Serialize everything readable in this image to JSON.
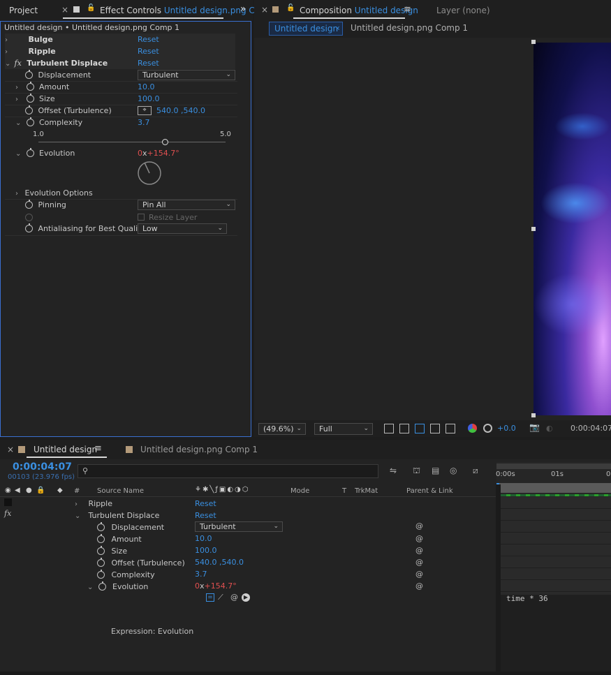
{
  "project_tab": "Project",
  "effect_tab": {
    "label": "Effect Controls",
    "file": "Untitled design.png C"
  },
  "ec_header": "Untitled design • Untitled design.png Comp 1",
  "effects": [
    {
      "name": "Bulge",
      "reset": "Reset"
    },
    {
      "name": "Ripple",
      "reset": "Reset"
    },
    {
      "name": "Turbulent Displace",
      "reset": "Reset"
    }
  ],
  "fx_label": "fx",
  "props": {
    "displacement": {
      "label": "Displacement",
      "value": "Turbulent"
    },
    "amount": {
      "label": "Amount",
      "value": "10.0"
    },
    "size": {
      "label": "Size",
      "value": "100.0"
    },
    "offset": {
      "label": "Offset (Turbulence)",
      "value": "540.0 ,540.0"
    },
    "complexity": {
      "label": "Complexity",
      "value": "3.7",
      "slider_min": "1.0",
      "slider_max": "5.0",
      "slider_fraction": 0.675
    },
    "evolution": {
      "label": "Evolution",
      "rev": "0",
      "x": "x",
      "deg": "+154.7",
      "deg_unit": "°"
    },
    "evolution_options": "Evolution Options",
    "pinning": {
      "label": "Pinning",
      "value": "Pin All"
    },
    "resize_layer": "Resize Layer",
    "antialias": {
      "label": "Antialiasing for Best Quality",
      "value": "Low"
    }
  },
  "comp_tab": {
    "label": "Composition",
    "name": "Untitled design"
  },
  "layer_tab": "Layer (none)",
  "breadcrumbs": [
    "Untitled design",
    "Untitled design.png Comp 1"
  ],
  "viewer_bar": {
    "zoom": "(49.6%)",
    "resolution": "Full",
    "exposure": "+0.0",
    "timecode": "0:00:04:07"
  },
  "timeline": {
    "tab1": "Untitled design",
    "tab2": "Untitled design.png Comp 1",
    "timecode": "0:00:04:07",
    "frames": "00103 (23.976 fps)",
    "search_placeholder": "",
    "columns": {
      "hash": "#",
      "source": "Source Name",
      "mode": "Mode",
      "t": "T",
      "trkmat": "TrkMat",
      "parent": "Parent & Link"
    },
    "ruler": [
      "0:00s",
      "01s",
      "0"
    ],
    "rows": [
      {
        "label": "Ripple",
        "value": "Reset"
      },
      {
        "label": "Turbulent Displace",
        "value": "Reset"
      },
      {
        "label": "Displacement",
        "value": "Turbulent"
      },
      {
        "label": "Amount",
        "value": "10.0"
      },
      {
        "label": "Size",
        "value": "100.0"
      },
      {
        "label": "Offset (Turbulence)",
        "value": "540.0 ,540.0"
      },
      {
        "label": "Complexity",
        "value": "3.7"
      },
      {
        "label": "Evolution",
        "rev": "0",
        "x": "x",
        "deg": "+154.7",
        "deg_unit": "°"
      }
    ],
    "expression_label": "Expression: Evolution",
    "expression_code": "time * 36"
  },
  "colors": {
    "accent": "#3a8fe0",
    "keyframe_red": "#e05050",
    "panel": "#232323"
  }
}
